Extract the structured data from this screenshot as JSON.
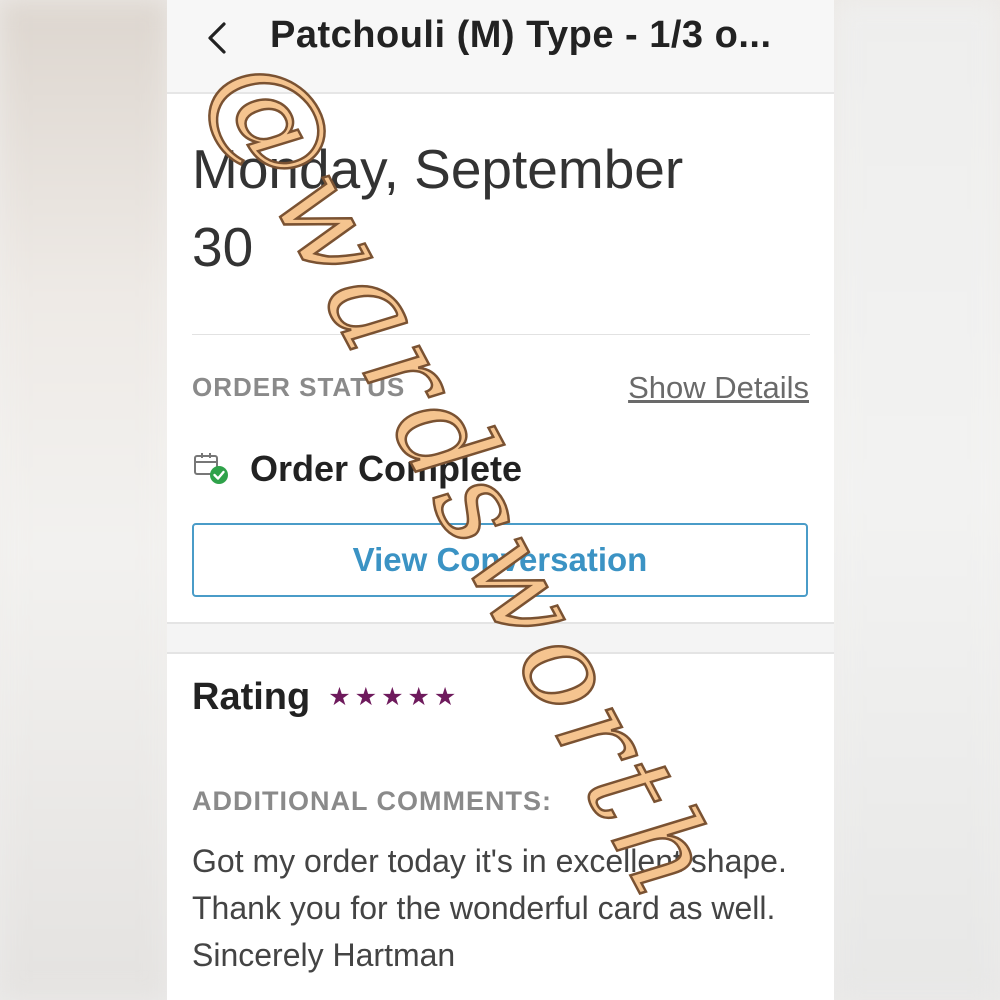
{
  "header": {
    "title": "Patchouli (M) Type - 1/3 o...",
    "back_icon": "chevron-left-icon"
  },
  "order": {
    "date_line1": "Monday, September",
    "date_line2": "30",
    "status_label": "ORDER STATUS",
    "show_details": "Show Details",
    "status_icon": "package-check-icon",
    "status_text": "Order Complete",
    "view_conversation": "View Conversation"
  },
  "review": {
    "rating_label": "Rating",
    "rating": 5,
    "rating_max": 5,
    "comments_label": "ADDITIONAL COMMENTS:",
    "comments_text": "Got my order today it's in excellent shape. Thank you for the wonderful card as well. Sincerely Hartman"
  },
  "watermark": {
    "text": "@wardsworth",
    "color": "#f5c48f"
  },
  "colors": {
    "accent_blue": "#3b93c4",
    "star_color": "#6e1a5c",
    "success_green": "#2fa24a"
  }
}
